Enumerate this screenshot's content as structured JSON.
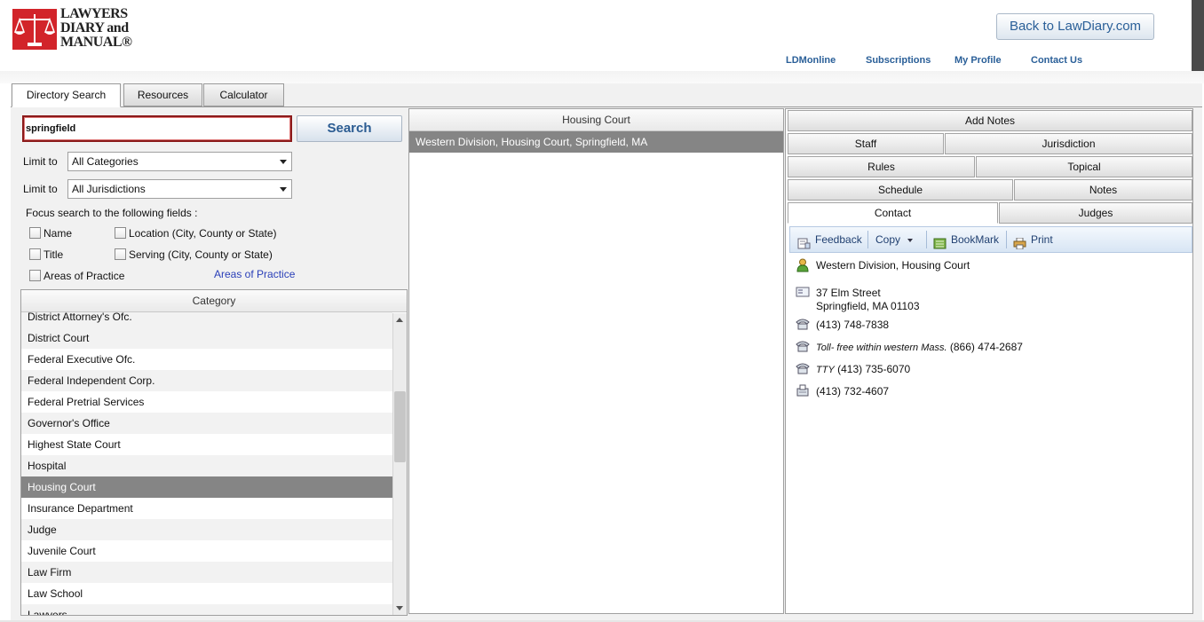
{
  "header": {
    "logo": {
      "line1": "LAWYERS",
      "line2": "DIARY and",
      "line3": "MANUAL®"
    },
    "back_button": "Back to LawDiary.com",
    "links": [
      "LDMonline",
      "Subscriptions",
      "My Profile",
      "Contact Us"
    ]
  },
  "tabs": [
    "Directory Search",
    "Resources",
    "Calculator"
  ],
  "search": {
    "value": "springfield",
    "button": "Search",
    "limit_label": "Limit to",
    "category_select": "All Categories",
    "jurisdiction_select": "All Jurisdictions",
    "focus_label": "Focus search to the following fields :",
    "checkboxes": [
      "Name",
      "Location (City, County or State)",
      "Title",
      "Serving (City, County or State)",
      "Areas of Practice"
    ],
    "areas_link": "Areas of Practice"
  },
  "category_list": {
    "header": "Category",
    "items": [
      "District Attorney's Ofc.",
      "District Court",
      "Federal Executive Ofc.",
      "Federal Independent Corp.",
      "Federal Pretrial Services",
      "Governor's Office",
      "Highest State Court",
      "Hospital",
      "Housing Court",
      "Insurance Department",
      "Judge",
      "Juvenile Court",
      "Law Firm",
      "Law School",
      "Lawyers"
    ],
    "selected": "Housing Court"
  },
  "results": {
    "header": "Housing Court",
    "items": [
      "Western Division, Housing Court, Springfield, MA"
    ]
  },
  "detail": {
    "buttons": {
      "add_notes": "Add Notes",
      "staff": "Staff",
      "jurisdiction": "Jurisdiction",
      "rules": "Rules",
      "topical": "Topical",
      "schedule": "Schedule",
      "notes": "Notes",
      "contact": "Contact",
      "judges": "Judges"
    },
    "toolbar": {
      "feedback": "Feedback",
      "copy": "Copy",
      "bookmark": "BookMark",
      "print": "Print"
    },
    "name": "Western Division, Housing Court",
    "address1": "37 Elm Street",
    "address2": "Springfield, MA 01103",
    "phone": "(413) 748-7838",
    "tollfree_label": "Toll- free within western Mass.",
    "tollfree": "(866) 474-2687",
    "tty_label": "TTY",
    "tty": "(413) 735-6070",
    "fax": "(413) 732-4607"
  },
  "colors": {
    "brand_red": "#d2242a",
    "link_blue": "#2a5f98",
    "selected_row": "#858585"
  }
}
